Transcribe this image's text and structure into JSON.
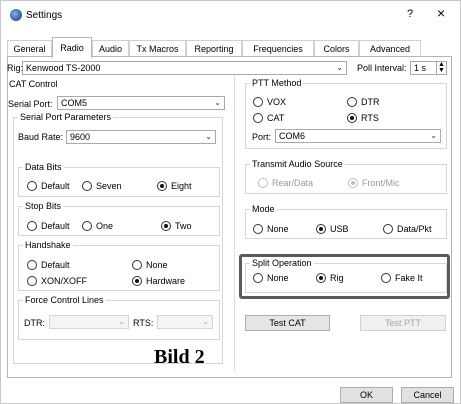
{
  "window": {
    "title": "Settings",
    "help": "?",
    "close": "×"
  },
  "tabs": [
    "General",
    "Radio",
    "Audio",
    "Tx Macros",
    "Reporting",
    "Frequencies",
    "Colors",
    "Advanced"
  ],
  "rig": {
    "label": "Rig:",
    "value": "Kenwood TS-2000",
    "poll_label": "Poll Interval:",
    "poll_value": "1 s"
  },
  "cat": {
    "title": "CAT Control",
    "serial_port_label": "Serial Port:",
    "serial_port_value": "COM5",
    "serial_params_title": "Serial Port Parameters",
    "baud_label": "Baud Rate:",
    "baud_value": "9600",
    "data_bits": {
      "title": "Data Bits",
      "options": [
        "Default",
        "Seven",
        "Eight"
      ],
      "selected": "Eight"
    },
    "stop_bits": {
      "title": "Stop Bits",
      "options": [
        "Default",
        "One",
        "Two"
      ],
      "selected": "Two"
    },
    "handshake": {
      "title": "Handshake",
      "options": [
        "Default",
        "None",
        "XON/XOFF",
        "Hardware"
      ],
      "selected": "Hardware"
    },
    "force_lines": {
      "title": "Force Control Lines",
      "dtr_label": "DTR:",
      "rts_label": "RTS:"
    }
  },
  "ptt": {
    "title": "PTT Method",
    "options": [
      "VOX",
      "DTR",
      "CAT",
      "RTS"
    ],
    "selected": "RTS",
    "port_label": "Port:",
    "port_value": "COM6"
  },
  "tx_audio": {
    "title": "Transmit Audio Source",
    "options": [
      "Rear/Data",
      "Front/Mic"
    ],
    "selected": "Front/Mic"
  },
  "mode": {
    "title": "Mode",
    "options": [
      "None",
      "USB",
      "Data/Pkt"
    ],
    "selected": "USB"
  },
  "split": {
    "title": "Split Operation",
    "options": [
      "None",
      "Rig",
      "Fake It"
    ],
    "selected": "Rig"
  },
  "buttons": {
    "test_cat": "Test CAT",
    "test_ptt": "Test PTT",
    "ok": "OK",
    "cancel": "Cancel"
  },
  "caption": "Bild 2"
}
